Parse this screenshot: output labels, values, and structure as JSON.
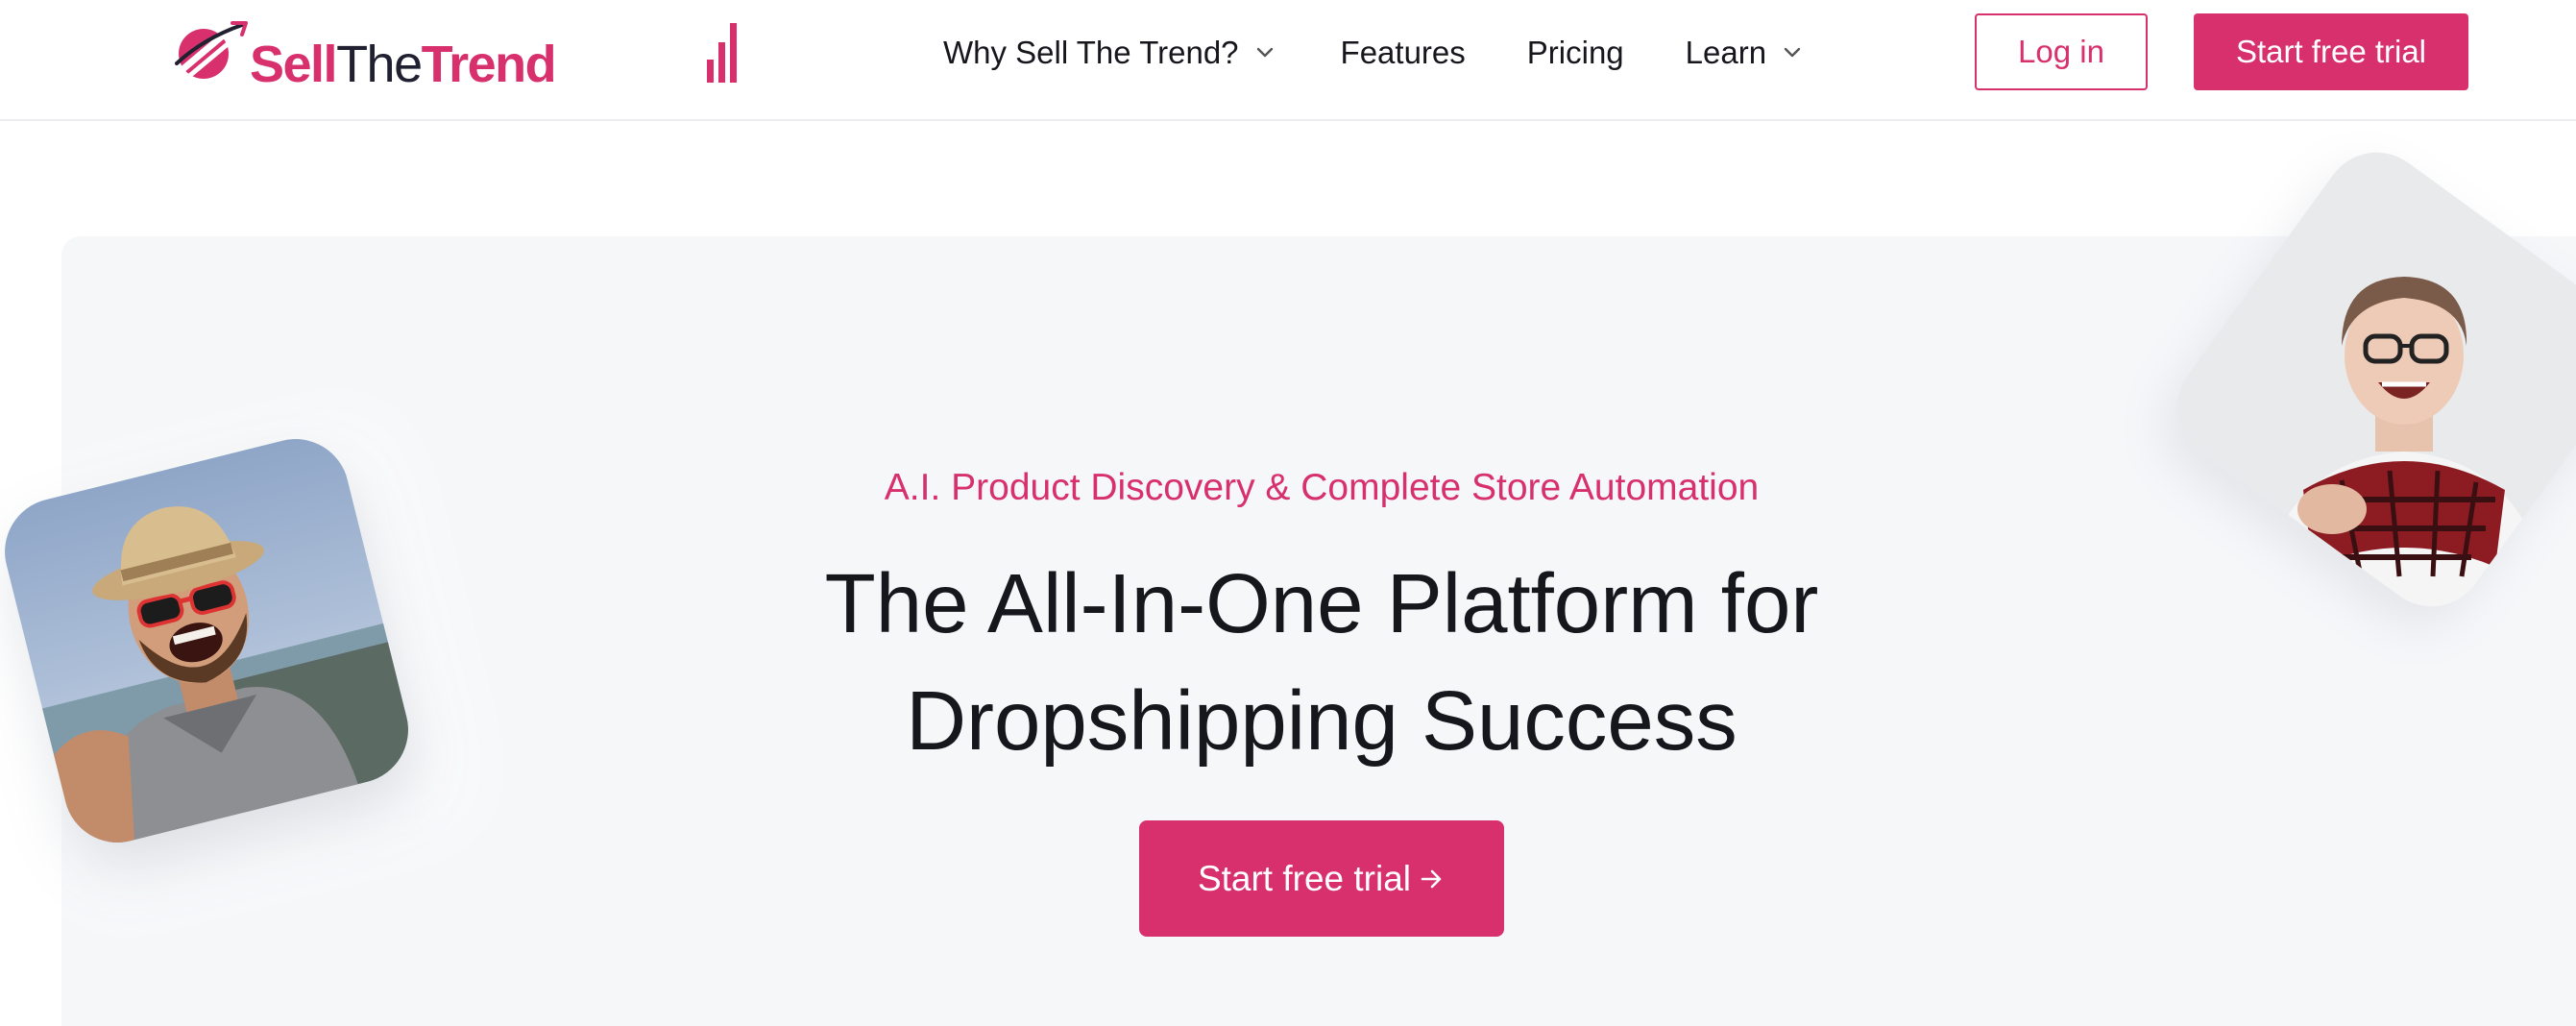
{
  "brand": {
    "name_part1": "Sell",
    "name_part2": "The",
    "name_part3": "Trend",
    "accent_color": "#d7306c",
    "logo_icon": "planet-orbit-icon"
  },
  "nav": {
    "items": [
      {
        "label": "Why Sell The Trend?",
        "has_dropdown": true
      },
      {
        "label": "Features",
        "has_dropdown": false
      },
      {
        "label": "Pricing",
        "has_dropdown": false
      },
      {
        "label": "Learn",
        "has_dropdown": true
      }
    ],
    "login_label": "Log in",
    "trial_label": "Start free trial"
  },
  "hero": {
    "tagline": "A.I. Product Discovery & Complete Store Automation",
    "headline_line1": "The All-In-One Platform for",
    "headline_line2": "Dropshipping Success",
    "cta_label": "Start free trial",
    "cta_icon": "arrow-right-icon",
    "background_color": "#f6f7f9"
  },
  "images": {
    "left_photo": "smiling-man-selfie-beach-photo",
    "right_photo": "laughing-woman-scarf-photo"
  }
}
